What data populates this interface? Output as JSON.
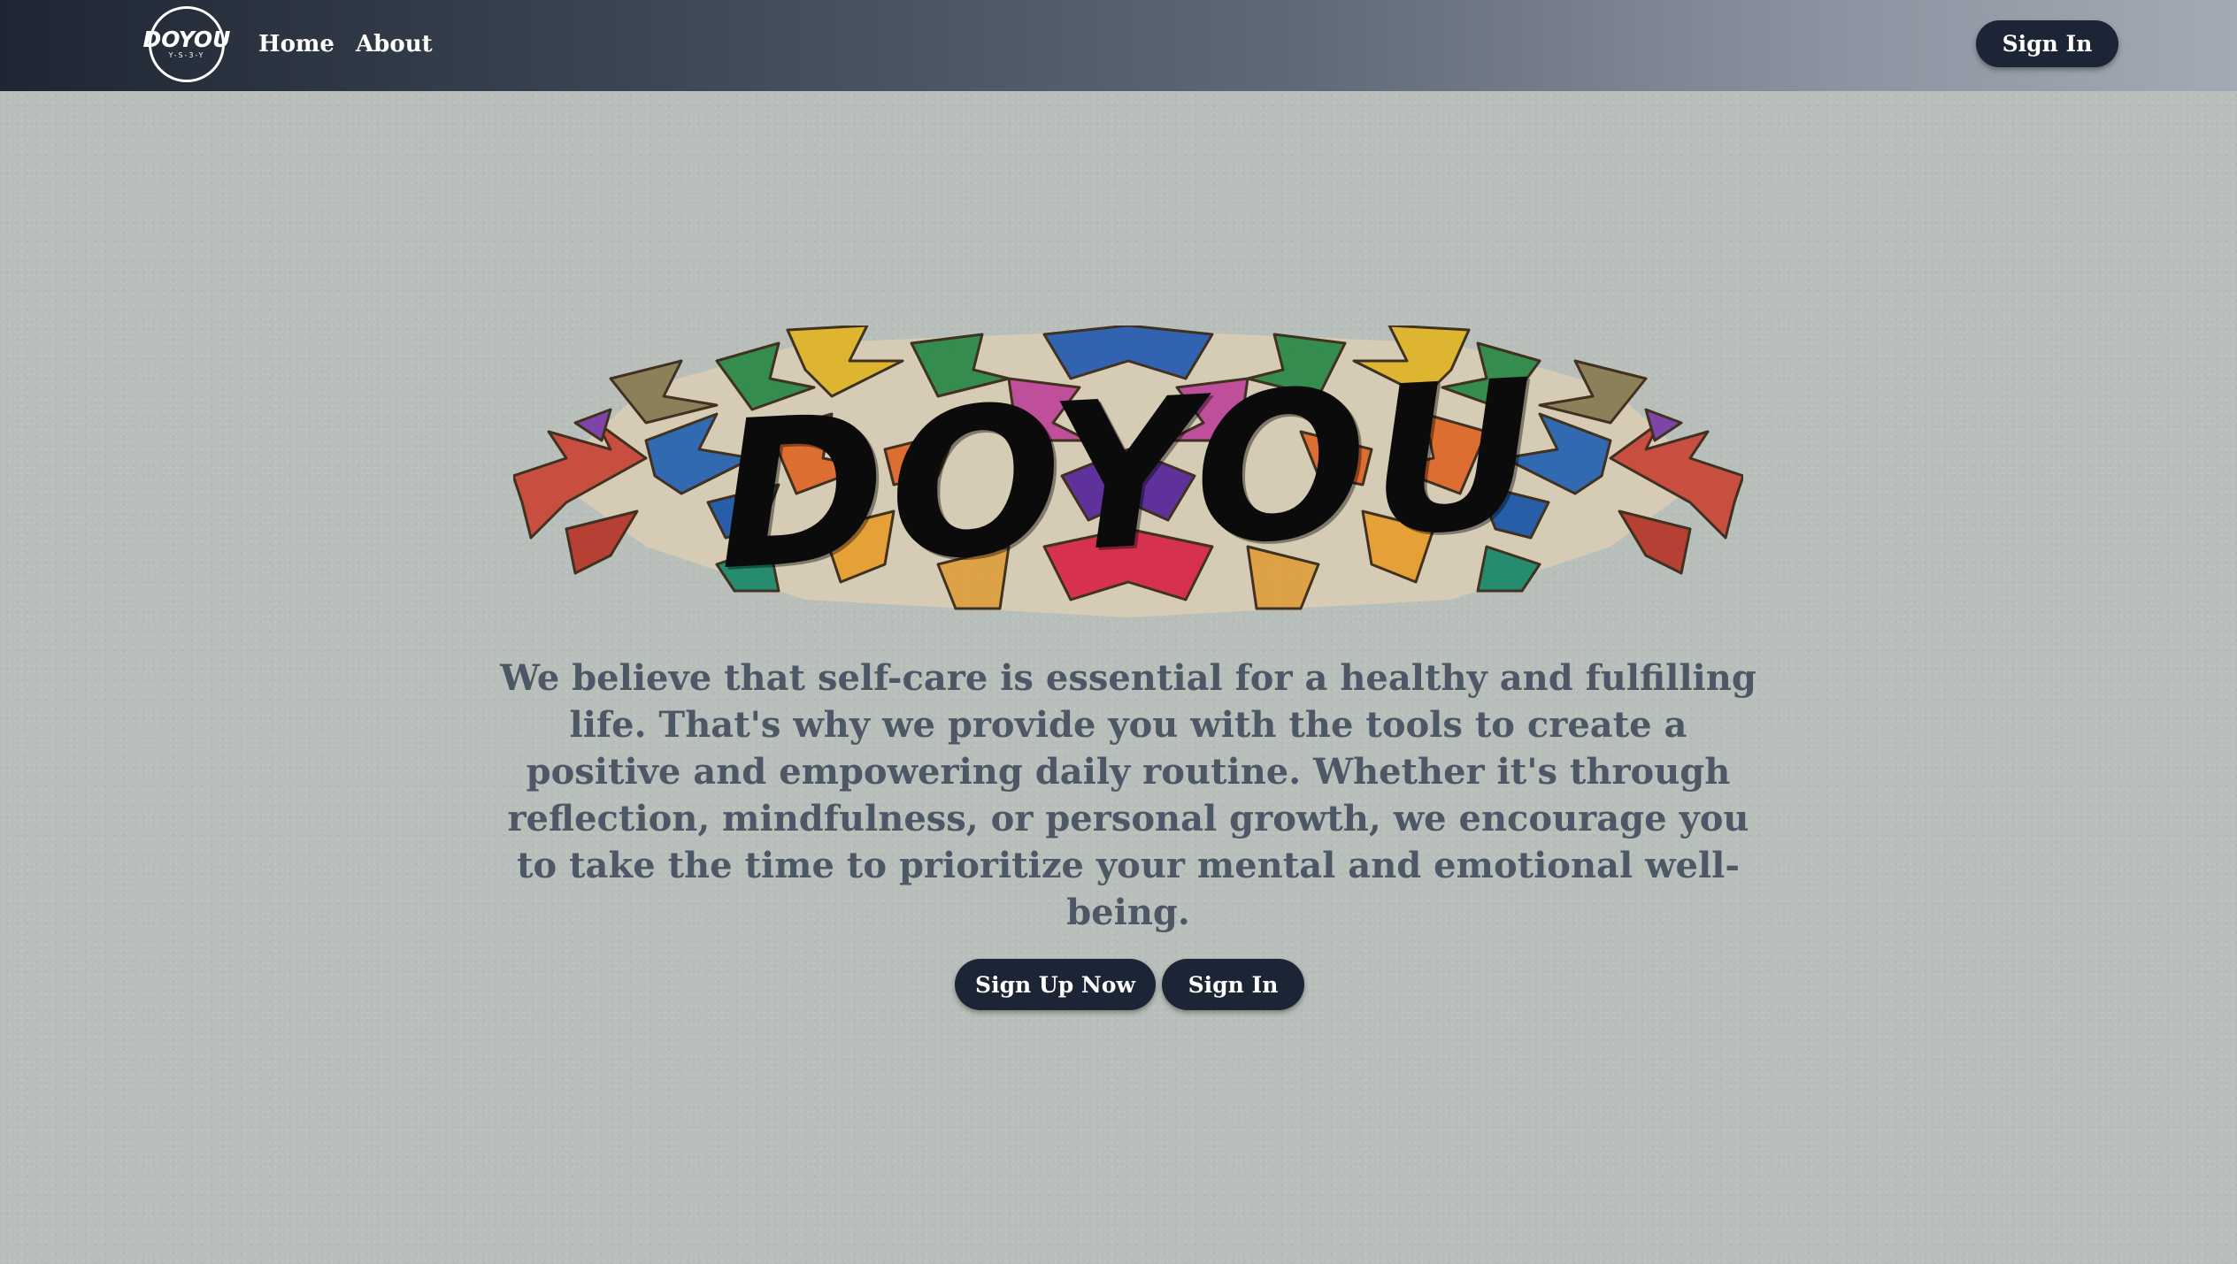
{
  "nav": {
    "logo_text": "DOYOU",
    "logo_sub": "Y-S-3-Y",
    "home_label": "Home",
    "about_label": "About",
    "signin_label": "Sign In"
  },
  "hero": {
    "logo_word": "DOYOU",
    "tagline": "We believe that self-care is essential for a healthy and fulfilling life. That's why we provide you with the tools to create a positive and empowering daily routine. Whether it's through reflection, mindfulness, or personal growth, we encourage you to take the time to prioritize your mental and emotional well-being.",
    "signup_label": "Sign Up Now",
    "signin_label": "Sign In"
  },
  "colors": {
    "button_bg": "#1c2535",
    "tagline_text": "#4d5866",
    "page_bg": "#b8bfba"
  }
}
